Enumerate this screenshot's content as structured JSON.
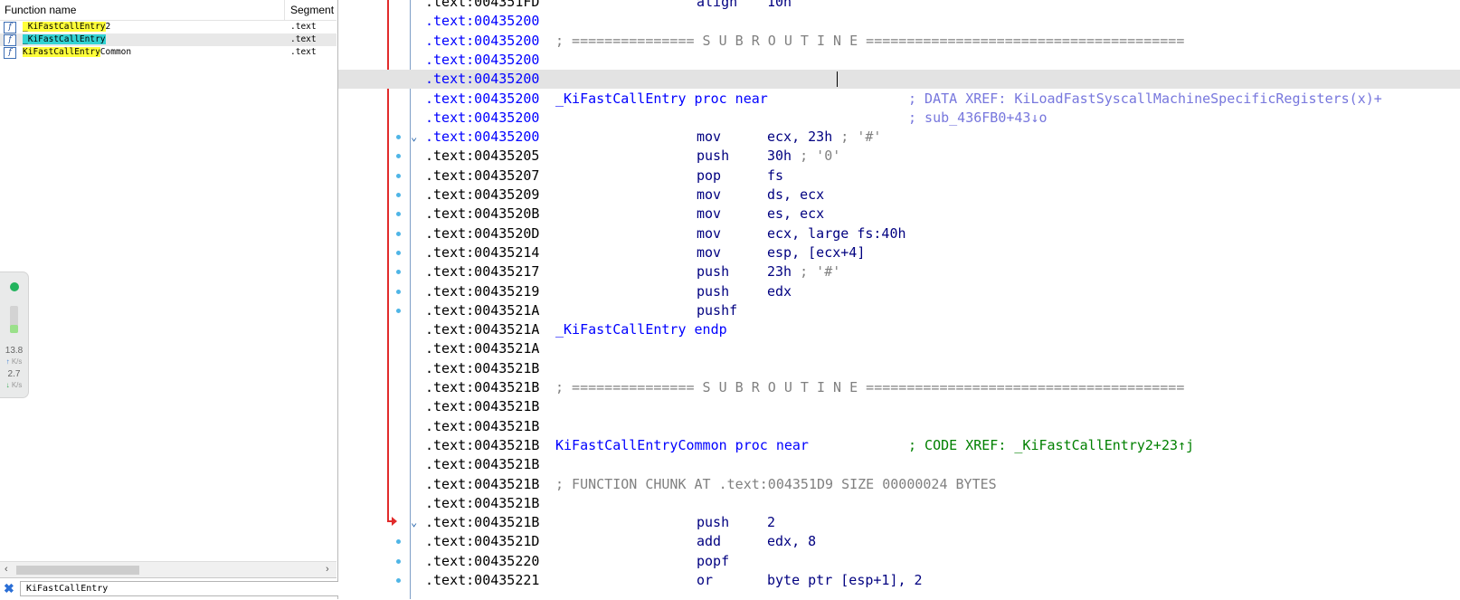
{
  "functions_pane": {
    "col_name": "Function name",
    "col_segment": "Segment",
    "rows": [
      {
        "prefix": "_",
        "hl": "KiFastCallEntry",
        "suffix": "2",
        "segment": ".text",
        "hl_color": "yellow",
        "selected": false
      },
      {
        "prefix": "_",
        "hl": "KiFastCallEntry",
        "suffix": "",
        "segment": ".text",
        "hl_color": "cyan",
        "selected": true
      },
      {
        "prefix": "",
        "hl": "KiFastCallEntry",
        "suffix": "Common",
        "segment": ".text",
        "hl_color": "yellow",
        "selected": false
      }
    ],
    "icon_glyph": "f",
    "filter_value": "KiFastCallEntry",
    "scroll_left": "‹",
    "scroll_right": "›",
    "close_glyph": "✖"
  },
  "net_widget": {
    "bar_fill_fraction": 0.3,
    "up_value": "13.8",
    "up_unit": "K/s",
    "down_value": "2.7",
    "down_unit": "K/s"
  },
  "disassembly": {
    "lines": [
      {
        "addr": ".text:004351FD",
        "kind": "ins",
        "ins": "align",
        "ops": "10h",
        "addr_color": "blk"
      },
      {
        "addr": ".text:00435200",
        "kind": "empty",
        "addr_color": "blue"
      },
      {
        "addr": ".text:00435200",
        "kind": "comment",
        "text": "; =============== S U B R O U T I N E =======================================",
        "addr_color": "blue"
      },
      {
        "addr": ".text:00435200",
        "kind": "empty",
        "addr_color": "blue"
      },
      {
        "addr": ".text:00435200",
        "kind": "empty",
        "addr_color": "blue",
        "current": true
      },
      {
        "addr": ".text:00435200",
        "kind": "proc",
        "name": "_KiFastCallEntry proc near",
        "xref": "; DATA XREF: KiLoadFastSyscallMachineSpecificRegisters(x)+",
        "addr_color": "blue"
      },
      {
        "addr": ".text:00435200",
        "kind": "xrefonly",
        "xref": "; sub_436FB0+43↓o",
        "addr_color": "blue"
      },
      {
        "addr": ".text:00435200",
        "kind": "ins",
        "ins": "mov",
        "ops": "ecx, 23h",
        "cmt": " ; '#'",
        "addr_color": "blue",
        "bp": true,
        "fold": true
      },
      {
        "addr": ".text:00435205",
        "kind": "ins",
        "ins": "push",
        "ops": "30h",
        "cmt": " ; '0'",
        "addr_color": "blk",
        "bp": true
      },
      {
        "addr": ".text:00435207",
        "kind": "ins",
        "ins": "pop",
        "ops": "fs",
        "addr_color": "blk",
        "bp": true
      },
      {
        "addr": ".text:00435209",
        "kind": "ins",
        "ins": "mov",
        "ops": "ds, ecx",
        "addr_color": "blk",
        "bp": true
      },
      {
        "addr": ".text:0043520B",
        "kind": "ins",
        "ins": "mov",
        "ops": "es, ecx",
        "addr_color": "blk",
        "bp": true
      },
      {
        "addr": ".text:0043520D",
        "kind": "ins",
        "ins": "mov",
        "ops": "ecx, large fs:40h",
        "addr_color": "blk",
        "bp": true
      },
      {
        "addr": ".text:00435214",
        "kind": "ins",
        "ins": "mov",
        "ops": "esp, [ecx+4]",
        "addr_color": "blk",
        "bp": true
      },
      {
        "addr": ".text:00435217",
        "kind": "ins",
        "ins": "push",
        "ops": "23h",
        "cmt": " ; '#'",
        "addr_color": "blk",
        "bp": true
      },
      {
        "addr": ".text:00435219",
        "kind": "ins",
        "ins": "push",
        "ops": "edx",
        "addr_color": "blk",
        "bp": true
      },
      {
        "addr": ".text:0043521A",
        "kind": "ins",
        "ins": "pushf",
        "ops": "",
        "addr_color": "blk",
        "bp": true
      },
      {
        "addr": ".text:0043521A",
        "kind": "proc",
        "name": "_KiFastCallEntry endp",
        "xref": "",
        "addr_color": "blk"
      },
      {
        "addr": ".text:0043521A",
        "kind": "empty",
        "addr_color": "blk"
      },
      {
        "addr": ".text:0043521B",
        "kind": "empty",
        "addr_color": "blk"
      },
      {
        "addr": ".text:0043521B",
        "kind": "comment",
        "text": "; =============== S U B R O U T I N E =======================================",
        "addr_color": "blk"
      },
      {
        "addr": ".text:0043521B",
        "kind": "empty",
        "addr_color": "blk"
      },
      {
        "addr": ".text:0043521B",
        "kind": "empty",
        "addr_color": "blk"
      },
      {
        "addr": ".text:0043521B",
        "kind": "proc",
        "name": "KiFastCallEntryCommon proc near",
        "xref": "; CODE XREF: _KiFastCallEntry2+23↑j",
        "xref_green": true,
        "addr_color": "blk"
      },
      {
        "addr": ".text:0043521B",
        "kind": "empty",
        "addr_color": "blk"
      },
      {
        "addr": ".text:0043521B",
        "kind": "comment",
        "text": "; FUNCTION CHUNK AT .text:004351D9 SIZE 00000024 BYTES",
        "addr_color": "blk"
      },
      {
        "addr": ".text:0043521B",
        "kind": "empty",
        "addr_color": "blk"
      },
      {
        "addr": ".text:0043521B",
        "kind": "ins",
        "ins": "push",
        "ops": "2",
        "addr_color": "blk",
        "fold": true
      },
      {
        "addr": ".text:0043521D",
        "kind": "ins",
        "ins": "add",
        "ops": "edx, 8",
        "addr_color": "blk",
        "bp": true
      },
      {
        "addr": ".text:00435220",
        "kind": "ins",
        "ins": "popf",
        "ops": "",
        "addr_color": "blk",
        "bp": true
      },
      {
        "addr": ".text:00435221",
        "kind": "ins",
        "ins": "or",
        "ops": "byte ptr [esp+1], 2",
        "addr_color": "blk",
        "bp": true,
        "partial": true
      }
    ]
  }
}
